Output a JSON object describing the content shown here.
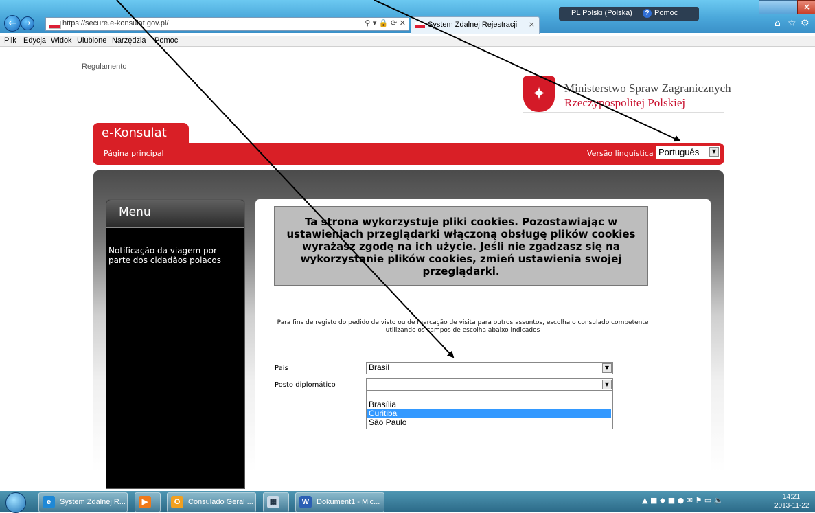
{
  "browser": {
    "address": "https://secure.e-konsulat.gov.pl/",
    "tab_title": "System Zdalnej Rejestracji",
    "tab_close": "×",
    "language_indicator": "PL Polski (Polska)",
    "help": "Pomoc",
    "menu": [
      "Plik",
      "Edycja",
      "Widok",
      "Ulubione",
      "Narzędzia",
      "Pomoc"
    ]
  },
  "page": {
    "regulamento": "Regulamento",
    "ministry_line1": "Ministerstwo Spraw Zagranicznych",
    "ministry_line2": "Rzeczypospolitej Polskiej",
    "site_title": "e-Konsulat",
    "home_link": "Página principal",
    "version_label": "Versão linguística",
    "language_selected": "Português",
    "menu_title": "Menu",
    "menu_items": [
      "Notificação da viagem por parte dos cidadãos polacos"
    ],
    "cookie_notice": "Ta strona wykorzystuje pliki cookies. Pozostawiając w ustawieniach przeglądarki włączoną obsługę plików cookies wyrażasz zgodę na ich użycie. Jeśli nie zgadzasz się na wykorzystanie plików cookies, zmień ustawienia swojej przeglądarki.",
    "instruction": "Para fins de registo do pedido de visto ou de marcação de visita para outros assuntos, escolha o consulado competente utilizando os campos de escolha abaixo indicados",
    "country_label": "País",
    "country_value": "Brasil",
    "post_label": "Posto diplomático",
    "post_value": "",
    "post_options": [
      "",
      "Brasília",
      "Curitiba",
      "São Paulo"
    ],
    "post_highlighted": "Curitiba"
  },
  "taskbar": {
    "items": [
      "System Zdalnej R...",
      "",
      "Consulado Geral ...",
      "",
      "Dokument1 - Mic..."
    ],
    "time": "14:21",
    "date": "2013-11-22"
  },
  "colors": {
    "brand_red": "#d91f26",
    "highlight": "#3399ff"
  }
}
